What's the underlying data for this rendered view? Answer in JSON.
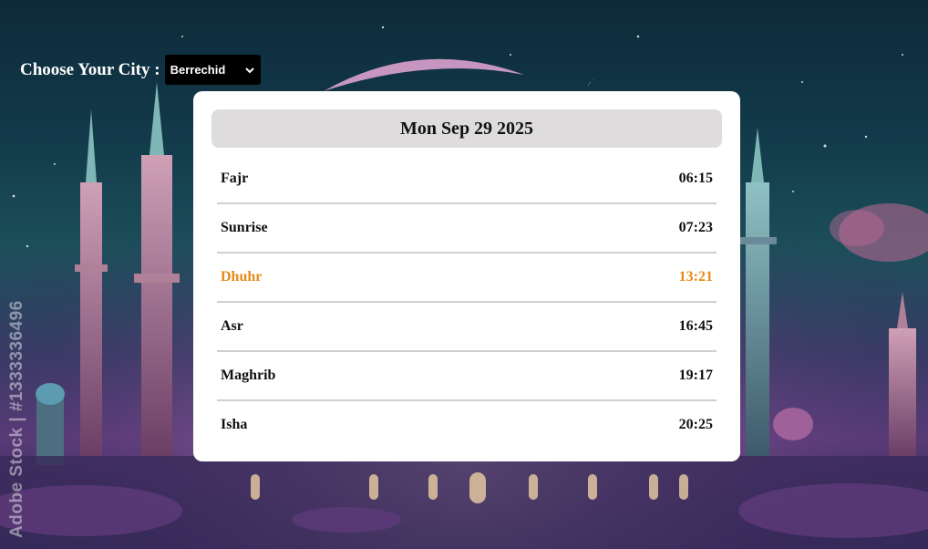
{
  "header": {
    "city_label": "Choose Your City :",
    "selected_city": "Berrechid"
  },
  "watermark": "Adobe Stock | #1333336496",
  "date": "Mon Sep 29 2025",
  "prayers": [
    {
      "name": "Fajr",
      "time": "06:15"
    },
    {
      "name": "Sunrise",
      "time": "07:23"
    },
    {
      "name": "Dhuhr",
      "time": "13:21"
    },
    {
      "name": "Asr",
      "time": "16:45"
    },
    {
      "name": "Maghrib",
      "time": "19:17"
    },
    {
      "name": "Isha",
      "time": "20:25"
    }
  ],
  "active_prayer_index": 2,
  "colors": {
    "active": "#e88a17",
    "date_bar": "#dedcdc",
    "card": "#ffffff"
  }
}
